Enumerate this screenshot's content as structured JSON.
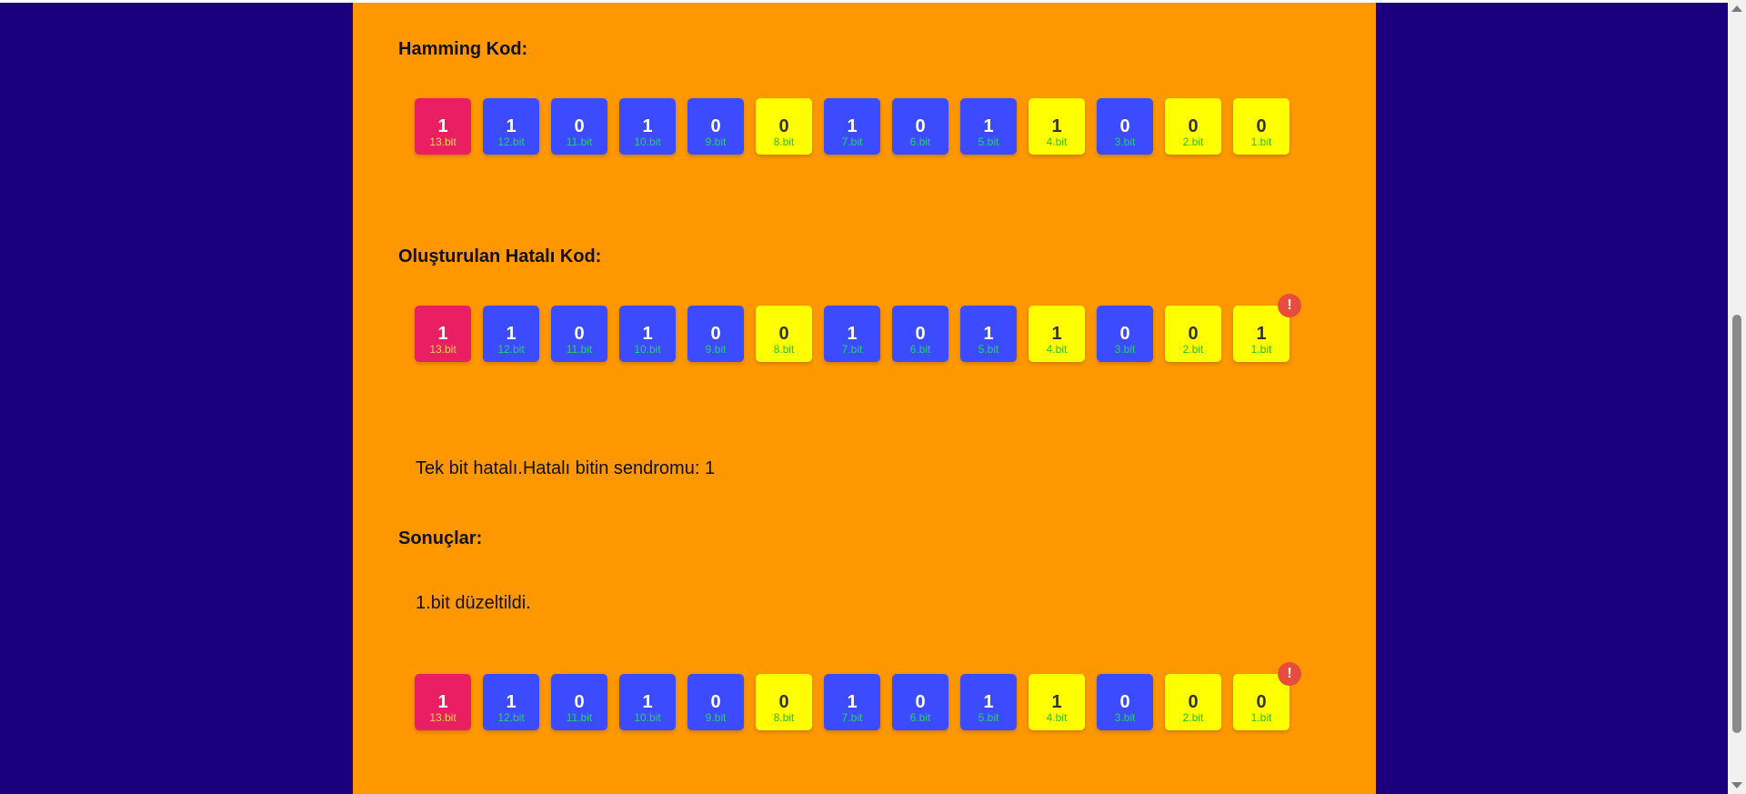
{
  "headings": {
    "hamming": "Hamming Kod:",
    "faulty": "Oluşturulan Hatalı Kod:",
    "results": "Sonuçlar:"
  },
  "messages": {
    "syndrome": "Tek bit hatalı.Hatalı bitin sendromu: 1",
    "corrected": "1.bit düzeltildi."
  },
  "error_marker": "!",
  "colors": {
    "page_background": "#1a007c",
    "panel": "#ff9800",
    "high_bit": "#e91e63",
    "data_bit": "#3d4bff",
    "parity_bit": "#ffff00",
    "error_badge": "#e74c3c"
  },
  "hamming_code": {
    "bits": [
      {
        "value": "1",
        "label": "13.bit",
        "type": "high"
      },
      {
        "value": "1",
        "label": "12.bit",
        "type": "data"
      },
      {
        "value": "0",
        "label": "11.bit",
        "type": "data"
      },
      {
        "value": "1",
        "label": "10.bit",
        "type": "data"
      },
      {
        "value": "0",
        "label": "9.bit",
        "type": "data"
      },
      {
        "value": "0",
        "label": "8.bit",
        "type": "parity"
      },
      {
        "value": "1",
        "label": "7.bit",
        "type": "data"
      },
      {
        "value": "0",
        "label": "6.bit",
        "type": "data"
      },
      {
        "value": "1",
        "label": "5.bit",
        "type": "data"
      },
      {
        "value": "1",
        "label": "4.bit",
        "type": "parity"
      },
      {
        "value": "0",
        "label": "3.bit",
        "type": "data"
      },
      {
        "value": "0",
        "label": "2.bit",
        "type": "parity"
      },
      {
        "value": "0",
        "label": "1.bit",
        "type": "parity"
      }
    ]
  },
  "faulty_code": {
    "bits": [
      {
        "value": "1",
        "label": "13.bit",
        "type": "high"
      },
      {
        "value": "1",
        "label": "12.bit",
        "type": "data"
      },
      {
        "value": "0",
        "label": "11.bit",
        "type": "data"
      },
      {
        "value": "1",
        "label": "10.bit",
        "type": "data"
      },
      {
        "value": "0",
        "label": "9.bit",
        "type": "data"
      },
      {
        "value": "0",
        "label": "8.bit",
        "type": "parity"
      },
      {
        "value": "1",
        "label": "7.bit",
        "type": "data"
      },
      {
        "value": "0",
        "label": "6.bit",
        "type": "data"
      },
      {
        "value": "1",
        "label": "5.bit",
        "type": "data"
      },
      {
        "value": "1",
        "label": "4.bit",
        "type": "parity"
      },
      {
        "value": "0",
        "label": "3.bit",
        "type": "data"
      },
      {
        "value": "0",
        "label": "2.bit",
        "type": "parity"
      },
      {
        "value": "1",
        "label": "1.bit",
        "type": "parity",
        "error": true
      }
    ]
  },
  "corrected_code": {
    "bits": [
      {
        "value": "1",
        "label": "13.bit",
        "type": "high"
      },
      {
        "value": "1",
        "label": "12.bit",
        "type": "data"
      },
      {
        "value": "0",
        "label": "11.bit",
        "type": "data"
      },
      {
        "value": "1",
        "label": "10.bit",
        "type": "data"
      },
      {
        "value": "0",
        "label": "9.bit",
        "type": "data"
      },
      {
        "value": "0",
        "label": "8.bit",
        "type": "parity"
      },
      {
        "value": "1",
        "label": "7.bit",
        "type": "data"
      },
      {
        "value": "0",
        "label": "6.bit",
        "type": "data"
      },
      {
        "value": "1",
        "label": "5.bit",
        "type": "data"
      },
      {
        "value": "1",
        "label": "4.bit",
        "type": "parity"
      },
      {
        "value": "0",
        "label": "3.bit",
        "type": "data"
      },
      {
        "value": "0",
        "label": "2.bit",
        "type": "parity"
      },
      {
        "value": "0",
        "label": "1.bit",
        "type": "parity",
        "error": true
      }
    ]
  }
}
